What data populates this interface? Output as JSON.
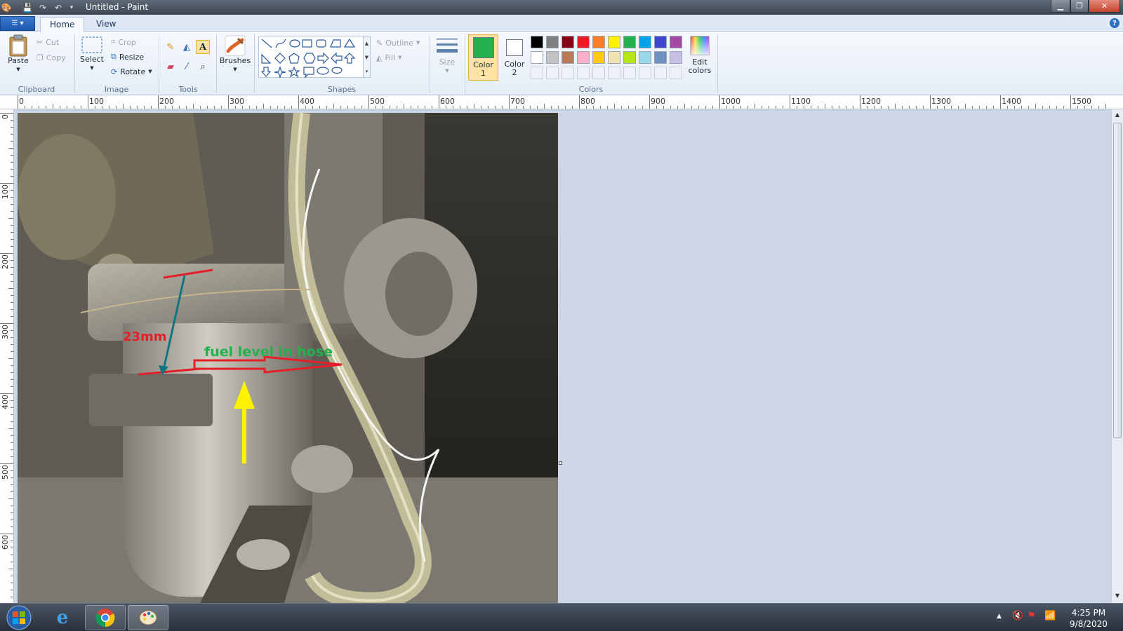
{
  "window": {
    "title": "Untitled - Paint"
  },
  "tabs": [
    {
      "label": "Home"
    },
    {
      "label": "View"
    }
  ],
  "ribbon": {
    "clipboard": {
      "label": "Clipboard",
      "paste": "Paste",
      "cut": "Cut",
      "copy": "Copy"
    },
    "image": {
      "label": "Image",
      "select": "Select",
      "crop": "Crop",
      "resize": "Resize",
      "rotate": "Rotate"
    },
    "tools": {
      "label": "Tools"
    },
    "brushes": {
      "label": "Brushes"
    },
    "shapes": {
      "label": "Shapes",
      "outline": "Outline",
      "fill": "Fill"
    },
    "size": {
      "label": "Size"
    },
    "colors": {
      "label": "Colors",
      "color1_line1": "Color",
      "color1_line2": "1",
      "color2_line1": "Color",
      "color2_line2": "2",
      "edit_line1": "Edit",
      "edit_line2": "colors",
      "color1_value": "#22b14c",
      "color2_value": "#ffffff",
      "palette_row1": [
        "#000000",
        "#7f7f7f",
        "#880015",
        "#ed1c24",
        "#ff7f27",
        "#fff200",
        "#22b14c",
        "#00a2e8",
        "#3f48cc",
        "#a349a4"
      ],
      "palette_row2": [
        "#ffffff",
        "#c3c3c3",
        "#b97a57",
        "#ffaec9",
        "#ffc90e",
        "#efe4b0",
        "#b5e61d",
        "#99d9ea",
        "#7092be",
        "#c8bfe7"
      ]
    }
  },
  "ruler": {
    "h_labels": [
      "0",
      "100",
      "200",
      "300",
      "400",
      "500",
      "600",
      "700",
      "800",
      "900",
      "1000",
      "1100",
      "1200",
      "1300",
      "1400",
      "1500"
    ],
    "v_labels": [
      "0",
      "100",
      "200",
      "300",
      "400",
      "500",
      "600"
    ]
  },
  "annotations": {
    "measure": "23mm",
    "fuel": "fuel level in hose"
  },
  "taskbar": {
    "time": "4:25 PM",
    "date": "9/8/2020"
  }
}
